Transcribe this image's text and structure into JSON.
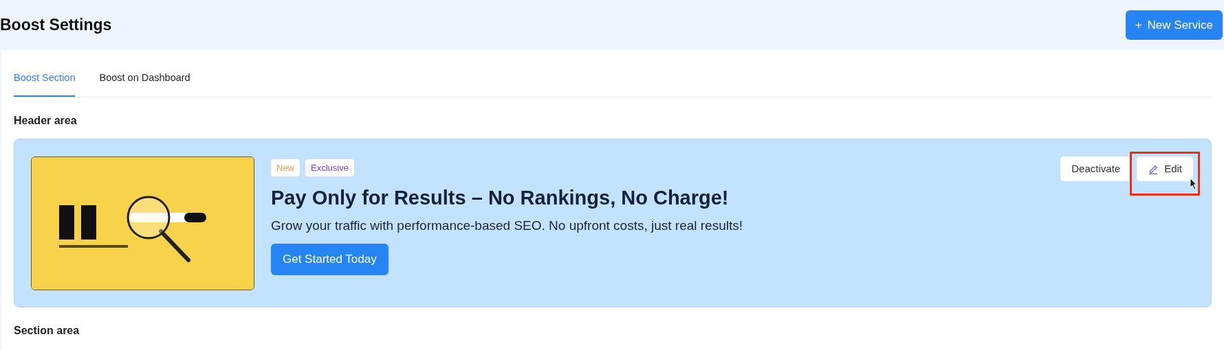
{
  "page": {
    "title": "Boost Settings",
    "new_button": {
      "icon": "+",
      "label": "New Service"
    }
  },
  "tabs": [
    {
      "label": "Boost Section",
      "selected": true
    },
    {
      "label": "Boost on Dashboard",
      "selected": false
    }
  ],
  "sections": [
    {
      "heading": "Header area",
      "banner": {
        "badges": [
          {
            "label": "New",
            "color": "#f59e42"
          },
          {
            "label": "Exclusive",
            "color": "#8b3fc9"
          }
        ],
        "title": "Pay Only for Results – No Rankings, No Charge!",
        "subtitle": "Grow your traffic with performance-based SEO. No upfront costs, just real results!",
        "cta": "Get Started Today",
        "actions": [
          {
            "label": "Deactivate",
            "kind": "plain",
            "highlighted": false
          },
          {
            "label": "Edit",
            "kind": "edit",
            "highlighted": true
          }
        ]
      }
    },
    {
      "heading": "Section area"
    }
  ]
}
